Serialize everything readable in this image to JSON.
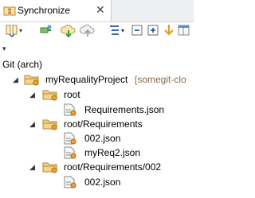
{
  "tab": {
    "title": "Synchronize",
    "close": "✕"
  },
  "toolbar": {
    "buttons": [
      {
        "name": "synchronize-icon"
      },
      {
        "name": "pin-icon"
      },
      {
        "name": "update-icon"
      },
      {
        "name": "commit-icon"
      },
      {
        "name": "mode-icon"
      },
      {
        "name": "collapse-all-icon"
      },
      {
        "name": "expand-all-icon"
      },
      {
        "name": "next-difference-icon"
      },
      {
        "name": "previous-difference-icon"
      },
      {
        "name": "layout-icon"
      }
    ],
    "dropdown_glyph": "▾"
  },
  "view_menu": "▾",
  "repo_label": "Git (arch)",
  "tree": {
    "project": {
      "name": "myRequalityProject",
      "repo": "[somegit-clo"
    },
    "groups": [
      {
        "folder": "root",
        "files": [
          "Requirements.json"
        ]
      },
      {
        "folder": "root/Requirements",
        "files": [
          "002.json",
          "myReq2.json"
        ]
      },
      {
        "folder": "root/Requirements/002",
        "files": [
          "002.json"
        ]
      }
    ],
    "expanded_glyph": "◢"
  },
  "colors": {
    "folder": "#e8c070",
    "change": "#f0a030",
    "file": "#f6f6f6"
  }
}
